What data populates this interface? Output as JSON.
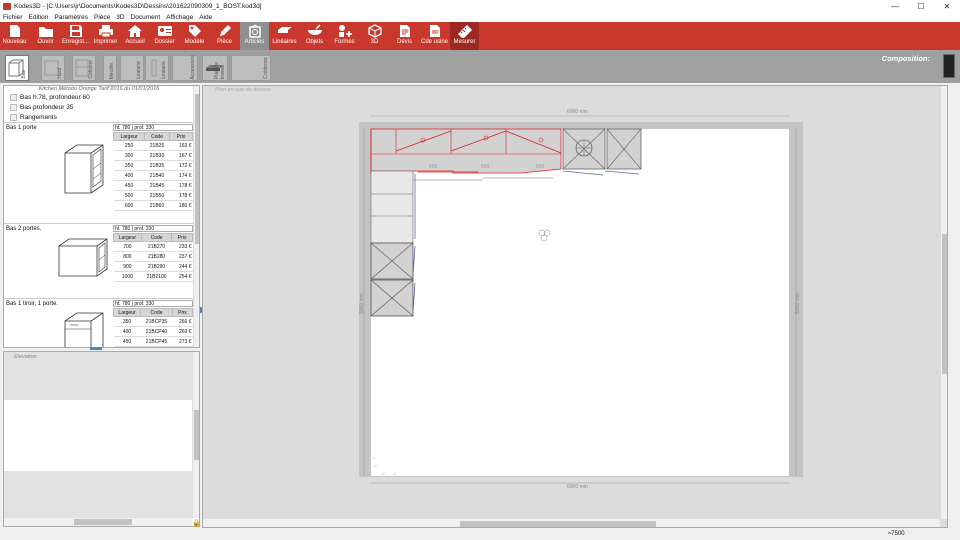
{
  "window": {
    "title": "Kodes3D - [C:\\Users\\jr\\Documents\\Kodes3D\\Dessins\\201622090309_1_BOST.kod3d]",
    "minimize": "—",
    "maximize": "☐",
    "close": "✕"
  },
  "menu": [
    "Fichier",
    "Edition",
    "Paramètres",
    "Pièce",
    "3D",
    "Document",
    "Affichage",
    "Aide"
  ],
  "toolbar": [
    {
      "label": "Nouveau",
      "icon": "new-file-icon"
    },
    {
      "label": "Ouvrir",
      "icon": "open-folder-icon"
    },
    {
      "label": "Enregist...",
      "icon": "save-icon"
    },
    {
      "label": "Imprimer",
      "icon": "print-icon"
    },
    {
      "label": "Accueil",
      "icon": "home-icon"
    },
    {
      "label": "Dossier",
      "icon": "dossier-card-icon"
    },
    {
      "label": "Modèle",
      "icon": "tag-icon"
    },
    {
      "label": "Pièce",
      "icon": "room-pencil-icon"
    },
    {
      "label": "Articles",
      "icon": "cabinet-icon"
    },
    {
      "label": "Linéaires",
      "icon": "worktop-icon"
    },
    {
      "label": "Objets",
      "icon": "bowl-icon"
    },
    {
      "label": "Formes",
      "icon": "shapes-icon"
    },
    {
      "label": "3D",
      "icon": "cube-3d-icon"
    },
    {
      "label": "Devis",
      "icon": "quote-document-icon"
    },
    {
      "label": "Cde usine",
      "icon": "factory-order-icon"
    },
    {
      "label": "Mesurer",
      "icon": "ruler-icon"
    }
  ],
  "composition_label": "Composition:",
  "categories": [
    "Bas",
    "Haut",
    "Colonne",
    "Meuble",
    "Linéaire",
    "Linéaire",
    "Accessoire",
    "Plan de travail",
    "Crédence"
  ],
  "catalog": {
    "header": "Kitchen Método Orange Tarif 2016 du 01/01/2016",
    "groups": [
      "Bas h.78, profondeur 60",
      "Bas profondeur 35",
      "Rangements"
    ],
    "columns": [
      "Largeur",
      "Code",
      "Prix"
    ],
    "articles": [
      {
        "title": "Bas 1 porte",
        "dims": "ht. 780 | prof. 330",
        "rows": [
          [
            "250",
            "21B25",
            "163 €"
          ],
          [
            "300",
            "21B30",
            "167 €"
          ],
          [
            "350",
            "21B35",
            "172 €"
          ],
          [
            "400",
            "21B40",
            "174 €"
          ],
          [
            "450",
            "21B45",
            "178 €"
          ],
          [
            "500",
            "21B50",
            "178 €"
          ],
          [
            "600",
            "21B60",
            "180 €"
          ]
        ]
      },
      {
        "title": "Bas 2 portes.",
        "dims": "ht. 780 | prof. 330",
        "rows": [
          [
            "700",
            "21B270",
            "233 €"
          ],
          [
            "800",
            "21B280",
            "237 €"
          ],
          [
            "900",
            "21B290",
            "244 €"
          ],
          [
            "1000",
            "21B2100",
            "254 €"
          ]
        ]
      },
      {
        "title": "Bas 1 tiroir, 1 porte.",
        "dims": "ht. 780 | prof. 330",
        "rows": [
          [
            "350",
            "21BCP35",
            "266 €"
          ],
          [
            "400",
            "21BCP40",
            "269 €"
          ],
          [
            "450",
            "21BCP45",
            "273 €"
          ]
        ]
      }
    ]
  },
  "elevation_label": "Elévation",
  "plan": {
    "view_title": "Plan en vue de dessus",
    "dim_top": "6000 mm",
    "dim_bottom": "6000 mm",
    "dim_left": "3000 mm",
    "dim_right": "5000 mm",
    "cabinet_widths": [
      "600",
      "600",
      "600"
    ]
  },
  "status": {
    "zoom": "≈7500"
  },
  "colors": {
    "ribbon": "#c8382d",
    "active_tool": "#8f8f8f",
    "selected_item": "#e02020"
  }
}
